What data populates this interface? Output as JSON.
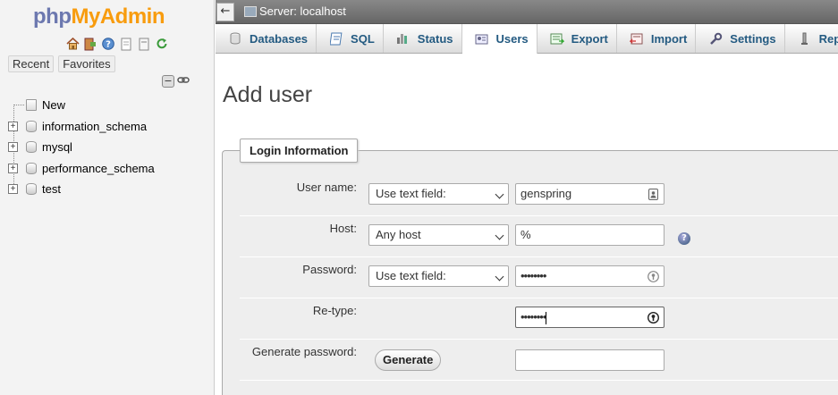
{
  "nav": {
    "logo_php": "php",
    "logo_myadmin": "MyAdmin",
    "recent_label": "Recent",
    "favorites_label": "Favorites",
    "tree": [
      {
        "label": "New"
      },
      {
        "label": "information_schema"
      },
      {
        "label": "mysql"
      },
      {
        "label": "performance_schema"
      },
      {
        "label": "test"
      }
    ]
  },
  "serverbar": {
    "back": "←",
    "label": "Server: localhost"
  },
  "tabs": [
    {
      "label": "Databases",
      "icon": "database-icon"
    },
    {
      "label": "SQL",
      "icon": "sql-icon"
    },
    {
      "label": "Status",
      "icon": "status-icon"
    },
    {
      "label": "Users",
      "icon": "users-icon",
      "active": true
    },
    {
      "label": "Export",
      "icon": "export-icon"
    },
    {
      "label": "Import",
      "icon": "import-icon"
    },
    {
      "label": "Settings",
      "icon": "wrench-icon"
    },
    {
      "label": "Rep",
      "icon": "replication-icon"
    }
  ],
  "page": {
    "title": "Add user",
    "legend": "Login Information"
  },
  "form": {
    "username": {
      "label": "User name:",
      "select": "Use text field:",
      "value": "genspring"
    },
    "host": {
      "label": "Host:",
      "select": "Any host",
      "value": "%"
    },
    "password": {
      "label": "Password:",
      "select": "Use text field:",
      "value": "••••••••"
    },
    "retype": {
      "label": "Re-type:",
      "value": "••••••••"
    },
    "generate": {
      "label": "Generate password:",
      "button": "Generate",
      "value": ""
    }
  }
}
